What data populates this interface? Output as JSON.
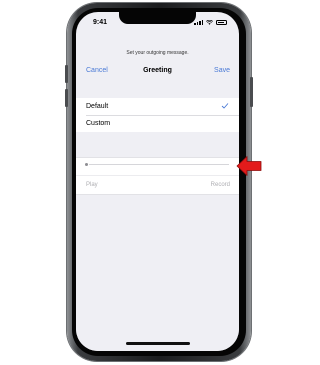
{
  "status": {
    "time": "9:41"
  },
  "sheet": {
    "prompt": "Set your outgoing message.",
    "nav": {
      "cancel": "Cancel",
      "title": "Greeting",
      "save": "Save"
    }
  },
  "options": [
    {
      "label": "Default",
      "selected": true
    },
    {
      "label": "Custom",
      "selected": false
    }
  ],
  "recorder": {
    "play_label": "Play",
    "record_label": "Record"
  },
  "colors": {
    "accent": "#4a7ad6",
    "callout_arrow": "#e31b1b",
    "disabled_text": "#aeaeb2"
  }
}
